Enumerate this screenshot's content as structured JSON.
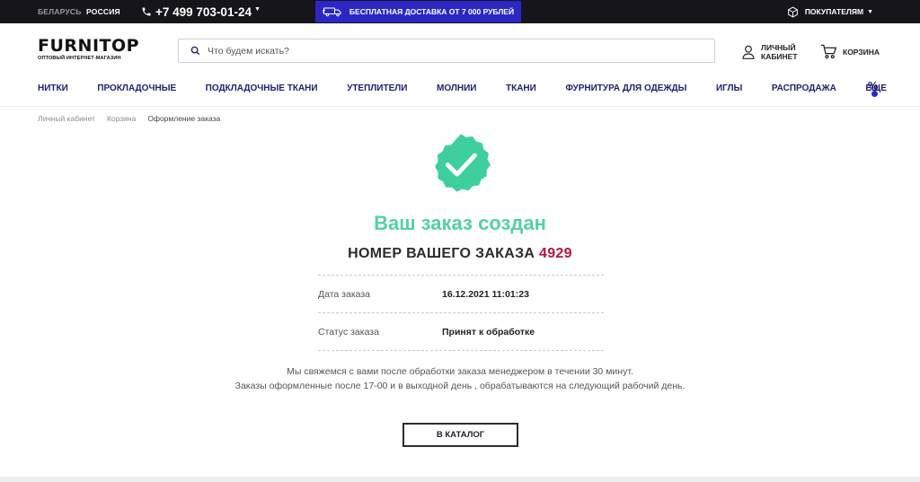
{
  "topbar": {
    "regions": [
      "БЕЛАРУСЬ",
      "РОССИЯ"
    ],
    "phone": "+7 499 703-01-24",
    "promo": "БЕСПЛАТНАЯ ДОСТАВКА ОТ 7 000 РУБЛЕЙ",
    "buyers_menu": "ПОКУПАТЕЛЯМ",
    "colors": {
      "bar_bg": "#15151b",
      "promo_bg": "#2c27c4"
    }
  },
  "header": {
    "logo_main": "FURNITOP",
    "logo_sub": "ОПТОВЫЙ ИНТЕРНЕТ-МАГАЗИН",
    "search_placeholder": "Что будем искать?",
    "account_label": "ЛИЧНЫЙ КАБИНЕТ",
    "cart_label": "КОРЗИНА"
  },
  "nav": {
    "items": [
      "НИТКИ",
      "ПРОКЛАДОЧНЫЕ",
      "ПОДКЛАДОЧНЫЕ ТКАНИ",
      "УТЕПЛИТЕЛИ",
      "МОЛНИИ",
      "ТКАНИ",
      "ФУРНИТУРА ДЛЯ ОДЕЖДЫ",
      "ИГЛЫ",
      "РАСПРОДАЖА",
      "ЕЩЕ"
    ],
    "sale_icon": "percent-icon"
  },
  "breadcrumb": [
    "Личный кабинет",
    "Корзина",
    "Оформление заказа"
  ],
  "confirmation": {
    "icon": "check-badge-icon",
    "title": "Ваш заказ создан",
    "order_label": "НОМЕР ВАШЕГО ЗАКАЗА",
    "order_number": "4929",
    "rows": [
      {
        "key": "Дата заказа",
        "value": "16.12.2021 11:01:23"
      },
      {
        "key": "Статус заказа",
        "value": "Принят к обработке"
      }
    ],
    "note_line1": "Мы свяжемся с вами после обработки заказа менеджером в течении 30 минут.",
    "note_line2": "Заказы оформленные после 17-00 и в выходной день , обрабатываются на следующий рабочий день.",
    "button": "В КАТАЛОГ",
    "colors": {
      "title": "#55d0a3",
      "order_number": "#b3173d",
      "badge": "#3fcf9f"
    }
  }
}
